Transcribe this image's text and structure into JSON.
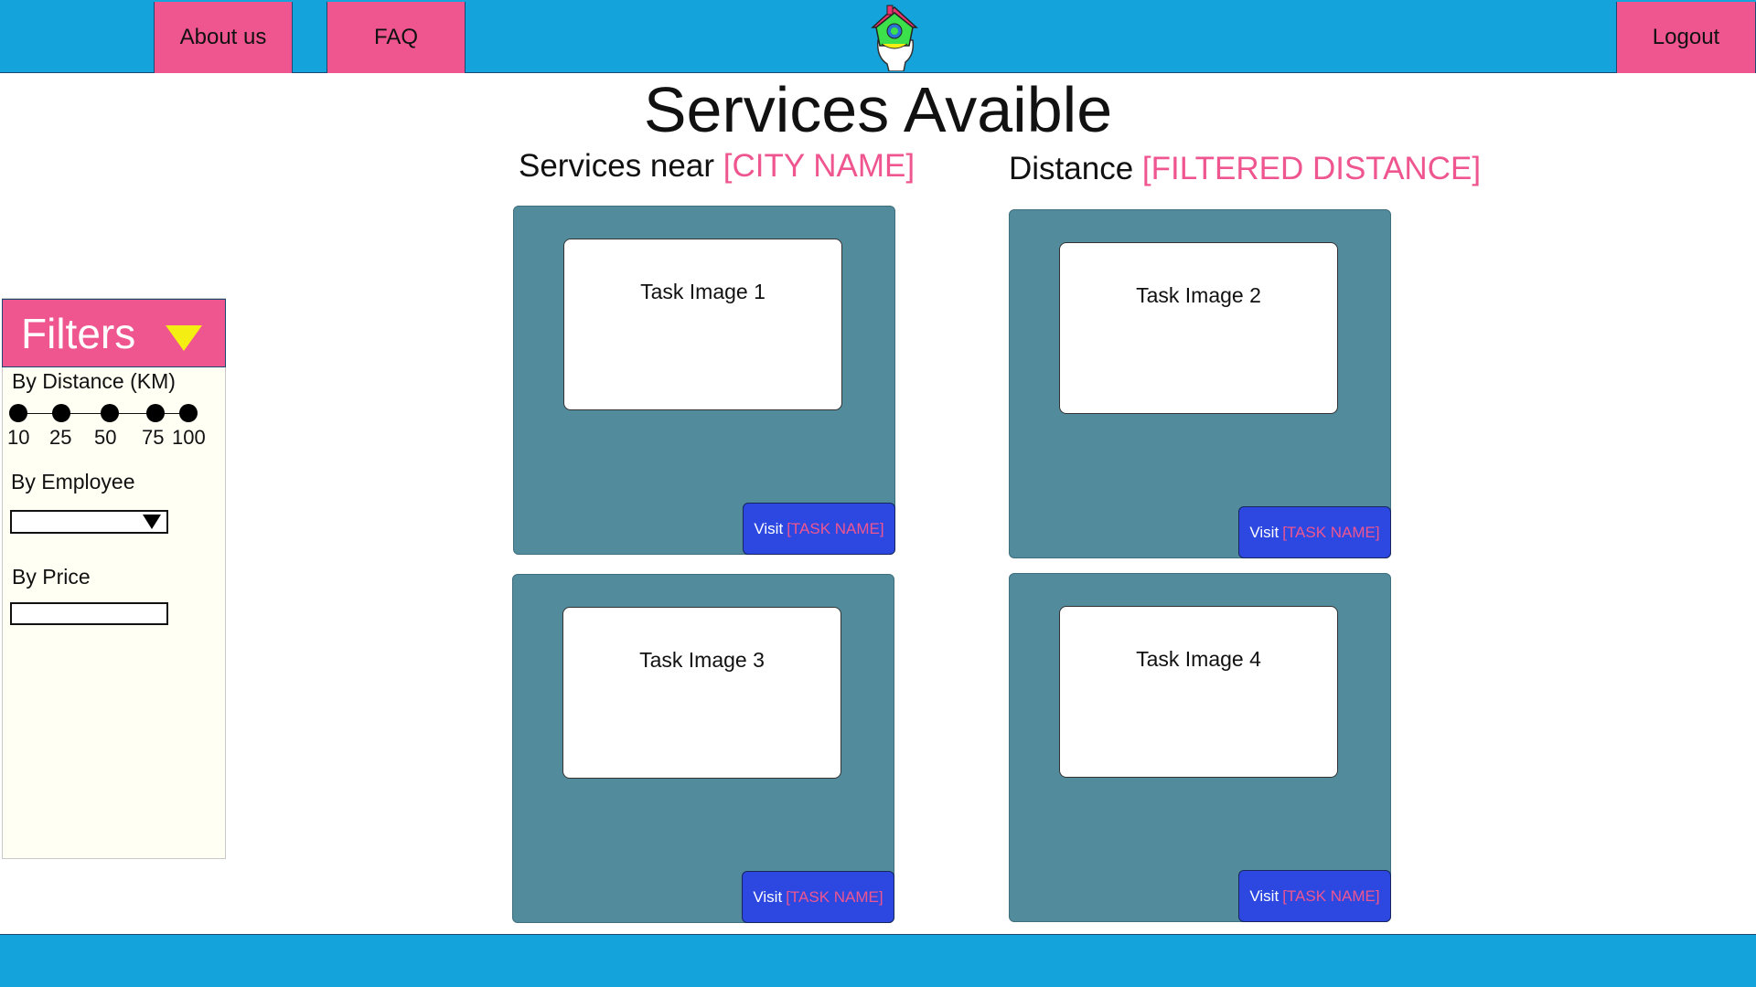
{
  "header": {
    "about_label": "About us",
    "faq_label": "FAQ",
    "logout_label": "Logout"
  },
  "page": {
    "title": "Services Avaible",
    "services_near_prefix": "Services near",
    "city_placeholder": "[CITY NAME]",
    "distance_prefix": "Distance",
    "distance_placeholder": "[FILTERED DISTANCE]"
  },
  "filters": {
    "title": "Filters",
    "by_distance_label": "By Distance (KM)",
    "distance_ticks": [
      "10",
      "25",
      "50",
      "75",
      "100"
    ],
    "by_employee_label": "By Employee",
    "by_price_label": "By Price"
  },
  "cards": [
    {
      "image_label": "Task Image 1",
      "visit_prefix": "Visit",
      "task_name": "[TASK NAME]"
    },
    {
      "image_label": "Task Image 2",
      "visit_prefix": "Visit",
      "task_name": "[TASK NAME]"
    },
    {
      "image_label": "Task Image 3",
      "visit_prefix": "Visit",
      "task_name": "[TASK NAME]"
    },
    {
      "image_label": "Task Image 4",
      "visit_prefix": "Visit",
      "task_name": "[TASK NAME]"
    }
  ],
  "colors": {
    "header_blue": "#14a3da",
    "accent_pink": "#ef5690",
    "card_teal": "#528b9b",
    "button_blue": "#2c48e0",
    "filter_toggle_yellow": "#f4ee12"
  },
  "icons": {
    "logo": "house-in-hand-logo",
    "filters_toggle": "triangle-down-icon",
    "select_arrow": "triangle-down-icon"
  }
}
